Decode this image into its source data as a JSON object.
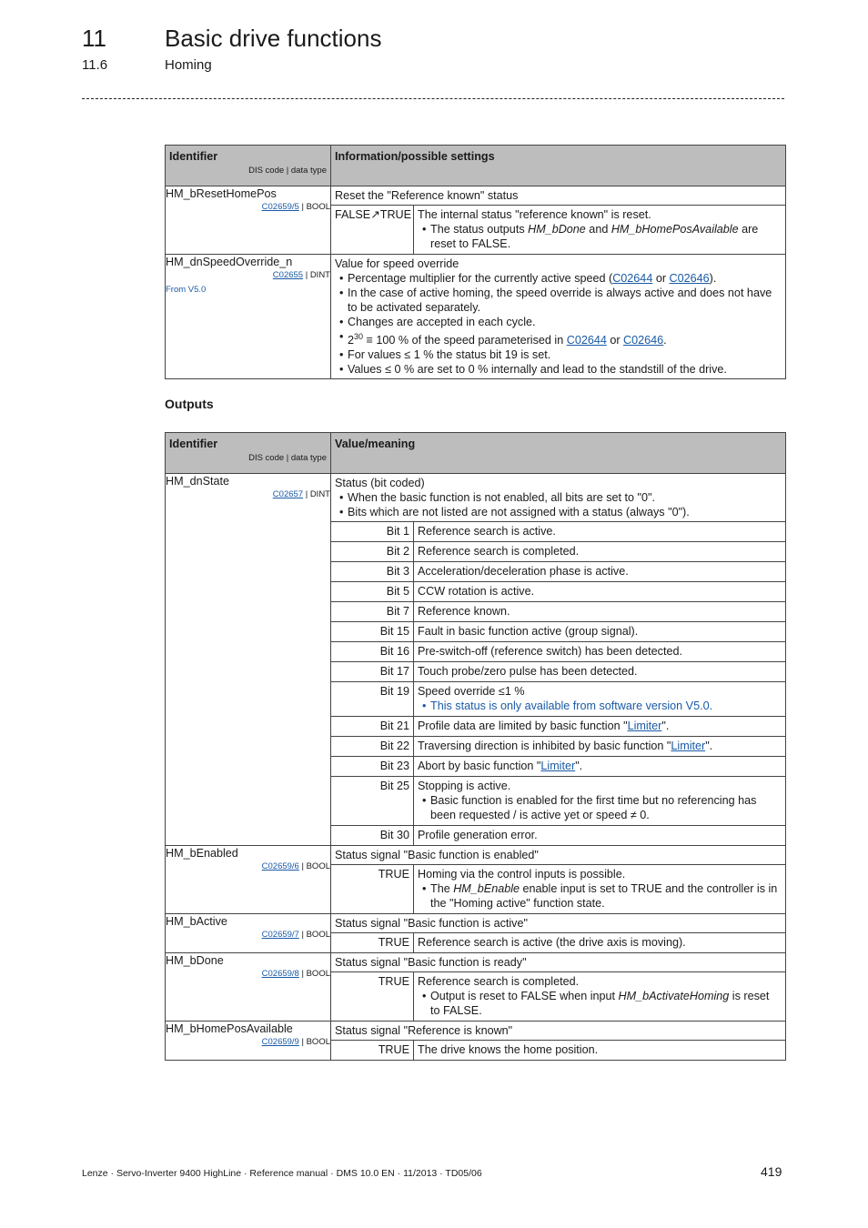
{
  "header": {
    "chapter_number": "11",
    "chapter_title": "Basic drive functions",
    "section_number": "11.6",
    "section_title": "Homing"
  },
  "inputs_table": {
    "col_identifier": "Identifier",
    "col_identifier_sub": "DIS code | data type",
    "col_info": "Information/possible settings",
    "rows": [
      {
        "name": "HM_bResetHomePos",
        "code": "C02659/5",
        "type": "| BOOL",
        "desc": "Reset the \"Reference known\" status",
        "values": [
          {
            "key": "FALSE↗TRUE",
            "text": "The internal status \"reference known\" is reset.",
            "bullet_pre": "The status outputs ",
            "bullet_i1": "HM_bDone",
            "bullet_mid": " and ",
            "bullet_i2": "HM_bHomePosAvailable",
            "bullet_post": " are reset to FALSE."
          }
        ]
      },
      {
        "name": "HM_dnSpeedOverride_n",
        "code": "C02655",
        "type": "| DINT",
        "note": "From V5.0",
        "desc": "Value for speed override",
        "bullets": {
          "b1_pre": "Percentage multiplier for the currently active speed (",
          "b1_l1": "C02644",
          "b1_mid": " or ",
          "b1_l2": "C02646",
          "b1_post": ").",
          "b2": "In the case of active homing, the speed override is always active and does not have to be activated separately.",
          "b3": "Changes are accepted in each cycle.",
          "b4_base": "2",
          "b4_exp": "30",
          "b4_pre": " ≡ 100 % of the speed parameterised in ",
          "b4_l1": "C02644",
          "b4_mid": " or ",
          "b4_l2": "C02646",
          "b4_post": ".",
          "b5": "For values ≤ 1 % the status bit 19 is set.",
          "b6": "Values ≤ 0 % are set to 0 % internally and lead to the standstill of the drive."
        }
      }
    ]
  },
  "outputs_title": "Outputs",
  "outputs_table": {
    "col_identifier": "Identifier",
    "col_identifier_sub": "DIS code | data type",
    "col_value": "Value/meaning",
    "dnState": {
      "name": "HM_dnState",
      "code": "C02657",
      "type": "| DINT",
      "desc": "Status (bit coded)",
      "b1": "When the basic function is not enabled, all bits are set to \"0\".",
      "b2": "Bits which are not listed are not assigned with a status (always \"0\").",
      "bits": [
        {
          "key": "Bit 1",
          "text": "Reference search is active."
        },
        {
          "key": "Bit 2",
          "text": "Reference search is completed."
        },
        {
          "key": "Bit 3",
          "text": "Acceleration/deceleration phase is active."
        },
        {
          "key": "Bit 5",
          "text": "CCW rotation is active."
        },
        {
          "key": "Bit 7",
          "text": "Reference known."
        },
        {
          "key": "Bit 15",
          "text": "Fault in basic function active (group signal)."
        },
        {
          "key": "Bit 16",
          "text": "Pre-switch-off (reference switch) has been detected."
        },
        {
          "key": "Bit 17",
          "text": "Touch probe/zero pulse has been detected."
        },
        {
          "key": "Bit 19",
          "text": "Speed override ≤1 %",
          "bullet": "This status is only available from software version V5.0."
        },
        {
          "key": "Bit 21",
          "pre": "Profile data are limited by basic function \"",
          "link": "Limiter",
          "post": "\"."
        },
        {
          "key": "Bit 22",
          "pre": "Traversing direction is inhibited by basic function \"",
          "link": "Limiter",
          "post": "\"."
        },
        {
          "key": "Bit 23",
          "pre": "Abort by basic function \"",
          "link": "Limiter",
          "post": "\"."
        },
        {
          "key": "Bit 25",
          "text": "Stopping is active.",
          "bullet": "Basic function is enabled for the first time but no referencing has been requested / is active yet or speed ≠ 0."
        },
        {
          "key": "Bit 30",
          "text": "Profile generation error."
        }
      ]
    },
    "bEnabled": {
      "name": "HM_bEnabled",
      "code": "C02659/6",
      "type": "| BOOL",
      "desc": "Status signal \"Basic function is enabled\"",
      "key": "TRUE",
      "text": "Homing via the control inputs is possible.",
      "b_pre": "The ",
      "b_i": "HM_bEnable",
      "b_post": " enable input is set to TRUE and the controller is in the \"Homing active\" function state."
    },
    "bActive": {
      "name": "HM_bActive",
      "code": "C02659/7",
      "type": "| BOOL",
      "desc": "Status signal \"Basic function is active\"",
      "key": "TRUE",
      "text": "Reference search is active (the drive axis is moving)."
    },
    "bDone": {
      "name": "HM_bDone",
      "code": "C02659/8",
      "type": "| BOOL",
      "desc": "Status signal \"Basic function is ready\"",
      "key": "TRUE",
      "text": "Reference search is completed.",
      "b_pre": "Output is reset to FALSE when input ",
      "b_i": "HM_bActivateHoming",
      "b_post": " is reset to FALSE."
    },
    "bHomePosAvailable": {
      "name": "HM_bHomePosAvailable",
      "code": "C02659/9",
      "type": "| BOOL",
      "desc": "Status signal \"Reference is known\"",
      "key": "TRUE",
      "text": "The drive knows the home position."
    }
  },
  "footer": {
    "text": "Lenze · Servo-Inverter 9400 HighLine · Reference manual · DMS 10.0 EN · 11/2013 · TD05/06",
    "page_number": "419"
  }
}
